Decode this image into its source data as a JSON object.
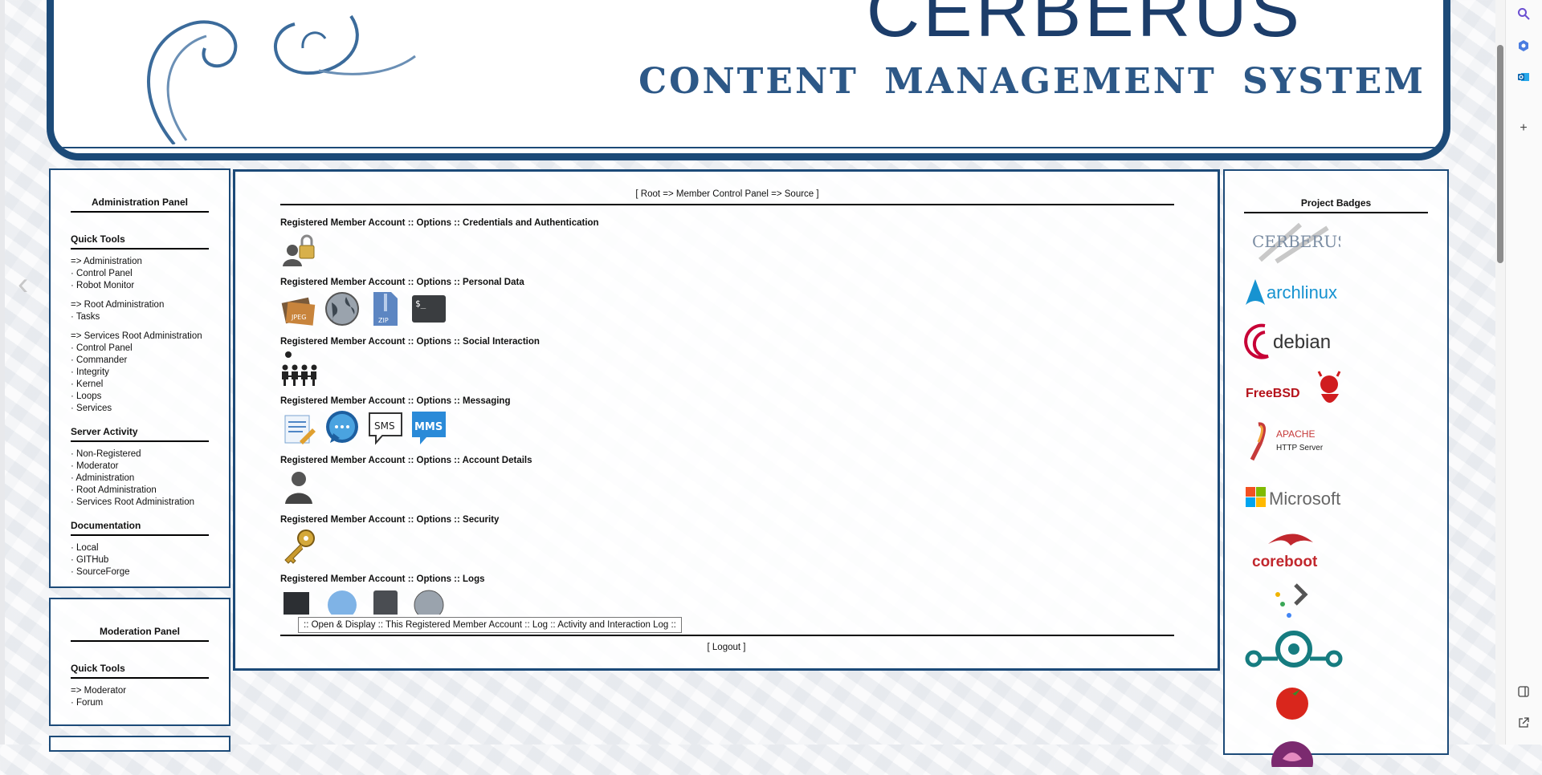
{
  "header": {
    "brand_title": "CERBERUS",
    "brand_subtitle": "CONTENT MANAGEMENT SYSTEM"
  },
  "admin_panel": {
    "title": "Administration Panel",
    "quick_tools_title": "Quick Tools",
    "quick_tools": [
      {
        "label": "=> Administration",
        "gap": false
      },
      {
        "label": "· Control Panel",
        "gap": false
      },
      {
        "label": "· Robot Monitor",
        "gap": false
      },
      {
        "label": "=> Root Administration",
        "gap": true
      },
      {
        "label": "· Tasks",
        "gap": false
      },
      {
        "label": "=> Services Root Administration",
        "gap": true
      },
      {
        "label": "· Control Panel",
        "gap": false
      },
      {
        "label": "· Commander",
        "gap": false
      },
      {
        "label": "· Integrity",
        "gap": false
      },
      {
        "label": "· Kernel",
        "gap": false
      },
      {
        "label": "· Loops",
        "gap": false
      },
      {
        "label": "· Services",
        "gap": false
      }
    ],
    "server_activity_title": "Server Activity",
    "server_activity": [
      "· Non-Registered",
      "· Moderator",
      "· Administration",
      "· Root Administration",
      "· Services Root Administration"
    ],
    "documentation_title": "Documentation",
    "documentation": [
      "· Local",
      "· GITHub",
      "· SourceForge"
    ]
  },
  "moderation_panel": {
    "title": "Moderation Panel",
    "quick_tools_title": "Quick Tools",
    "items": [
      "=> Moderator",
      "· Forum"
    ]
  },
  "main": {
    "breadcrumb": "[ Root => Member Control Panel => Source ]",
    "sections": [
      {
        "title": "Registered Member Account :: Options :: Credentials and Authentication",
        "icons": [
          "user-lock-icon"
        ]
      },
      {
        "title": "Registered Member Account :: Options :: Personal Data",
        "icons": [
          "photo-jpeg-icon",
          "globe-icon",
          "zip-file-icon",
          "terminal-icon"
        ]
      },
      {
        "title": "Registered Member Account :: Options :: Social Interaction",
        "icons": [
          "people-group-icon"
        ]
      },
      {
        "title": "Registered Member Account :: Options :: Messaging",
        "icons": [
          "compose-note-icon",
          "chat-bubble-icon",
          "sms-icon",
          "mms-icon"
        ]
      },
      {
        "title": "Registered Member Account :: Options :: Account Details",
        "icons": [
          "user-silhouette-icon"
        ]
      },
      {
        "title": "Registered Member Account :: Options :: Security",
        "icons": [
          "key-icon"
        ]
      },
      {
        "title": "Registered Member Account :: Options :: Logs",
        "icons": [
          "log-monitor-icon",
          "log-globe-icon",
          "log-device-icon",
          "log-world-icon"
        ]
      }
    ],
    "tooltip": ":: Open & Display :: This Registered Member Account :: Log :: Activity and Interaction Log ::",
    "logout_prefix": "[ ",
    "logout_label": "Logout",
    "logout_suffix": " ]"
  },
  "badges_panel": {
    "title": "Project Badges",
    "badges": [
      "CERBERUS",
      "archlinux",
      "debian",
      "FreeBSD",
      "APACHE",
      "HTTP Server",
      "Microsoft",
      "coreboot"
    ]
  },
  "colors": {
    "frame_blue": "#1c4a78",
    "title_blue": "#1c3d6a"
  }
}
